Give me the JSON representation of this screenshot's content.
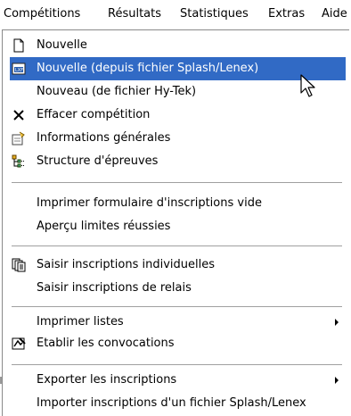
{
  "menubar": {
    "items": [
      "Compétitions",
      "Résultats",
      "Statistiques",
      "Extras",
      "Aide"
    ]
  },
  "menu": {
    "items": [
      {
        "label": "Nouvelle",
        "icon": "new-document-icon"
      },
      {
        "label": "Nouvelle (depuis fichier Splash/Lenex)",
        "icon": "lenex-file-icon",
        "highlighted": true
      },
      {
        "label": "Nouveau (de fichier Hy-Tek)"
      },
      {
        "label": "Effacer compétition",
        "icon": "delete-x-icon"
      },
      {
        "label": "Informations générales",
        "icon": "info-properties-icon"
      },
      {
        "label": "Structure d'épreuves",
        "icon": "tree-structure-icon"
      },
      {
        "label": "Imprimer formulaire d'inscriptions vide"
      },
      {
        "label": "Aperçu limites réussies"
      },
      {
        "label": "Saisir inscriptions individuelles",
        "icon": "entries-pages-icon"
      },
      {
        "label": "Saisir inscriptions de relais"
      },
      {
        "label": "Imprimer listes",
        "submenu": true
      },
      {
        "label": "Etablir les convocations",
        "icon": "convocation-icon"
      },
      {
        "label": "Exporter les inscriptions",
        "submenu": true
      },
      {
        "label": "Importer inscriptions d'un fichier Splash/Lenex"
      }
    ]
  },
  "colors": {
    "highlight": "#316ac5",
    "highlight_text": "#ffffff"
  }
}
